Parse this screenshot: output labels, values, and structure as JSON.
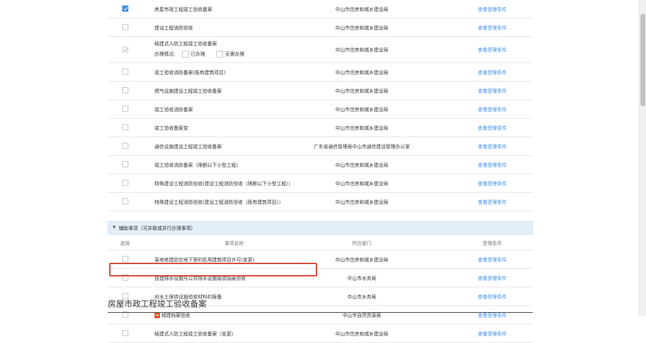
{
  "main_items": [
    {
      "name": "房屋市政工程竣工验收备案",
      "dept": "中山市住房和城乡建设局",
      "link": "查看受理条件",
      "state": "checked"
    },
    {
      "name": "建设工程消防验收",
      "dept": "中山市住房和城乡建设局",
      "link": "查看受理条件",
      "state": "unchecked"
    },
    {
      "name": "结建式人防工程竣工验收备案",
      "dept": "中山市住房和城乡建设局",
      "link": "查看受理条件",
      "state": "disabled",
      "sub": {
        "label": "办理情况:",
        "option1": "已办理",
        "option2": "无需办理"
      }
    },
    {
      "name": "竣工验收消防备案(既有建筑项目)",
      "dept": "中山市住房和城乡建设局",
      "link": "查看受理条件",
      "state": "unchecked"
    },
    {
      "name": "燃气设施建设工程竣工验收备案",
      "dept": "中山市住房和城乡建设局",
      "link": "查看受理条件",
      "state": "unchecked"
    },
    {
      "name": "竣工验收消防备案",
      "dept": "中山市住房和城乡建设局",
      "link": "查看受理条件",
      "state": "unchecked"
    },
    {
      "name": "竣工验收备案变",
      "dept": "中山市住房和城乡建设局",
      "link": "查看受理条件",
      "state": "unchecked"
    },
    {
      "name": "通信设施建设工程竣工验收备案",
      "dept": "广东省通信管理局中山市通信建设管理办公室",
      "link": "查看受理条件",
      "state": "unchecked"
    },
    {
      "name": "竣工验收消防备案（限额以下小型工程）",
      "dept": "中山市住房和城乡建设局",
      "link": "查看受理条件",
      "state": "unchecked"
    },
    {
      "name": "特殊建设工程消防验收(建设工程消防验收（限额以下小型工程））",
      "dept": "中山市住房和城乡建设局",
      "link": "查看受理条件",
      "state": "unchecked"
    },
    {
      "name": "特殊建设工程消防验收(建设工程消防验收（既有建筑项目））",
      "dept": "中山市住房和城乡建设局",
      "link": "查看受理条件",
      "state": "unchecked"
    }
  ],
  "aux_section": {
    "title": "辅助事项（可并联或并行办理事项）",
    "headers": {
      "select": "选择",
      "name": "事项名称",
      "dept": "所在部门",
      "cond": "受理条件"
    },
    "items": [
      {
        "name": "易地修建防空地下室的民用建筑项目许可(变更)",
        "dept": "中山市住房和城乡建设局",
        "link": "查看受理条件"
      },
      {
        "name": "自建排水设施与公共排水设施接驳隐蔽验收",
        "dept": "中山市水务局",
        "link": "查看受理条件"
      },
      {
        "name": "对水土保持设施验收材料的报备",
        "dept": "中山市水务局",
        "link": "查看受理条件"
      },
      {
        "name": "城建档案验收",
        "dept": "中山市自然资源局",
        "link": "查看受理条件",
        "badge": true
      },
      {
        "name": "结建式人防工程竣工验收备案（变更）",
        "dept": "中山市住房和城乡建设局",
        "link": "查看受理条件"
      }
    ]
  },
  "page_heading": "房屋市政工程竣工验收备案",
  "colors": {
    "accent": "#3d8ee6",
    "highlight": "#e0473c",
    "section_bg": "#e3eef9"
  },
  "icons": {
    "collapse": "chevron-down-icon",
    "badge": "file-badge-icon"
  }
}
